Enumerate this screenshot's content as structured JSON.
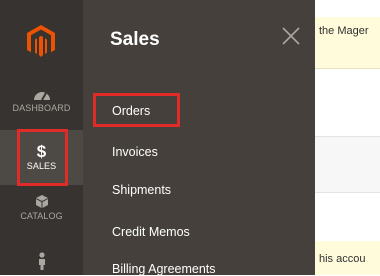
{
  "sidebar": {
    "logo_icon": "magento-logo-icon",
    "items": [
      {
        "label": "DASHBOARD",
        "icon": "speedometer-icon"
      },
      {
        "label": "SALES",
        "icon": "dollar-icon"
      },
      {
        "label": "CATALOG",
        "icon": "cube-icon"
      },
      {
        "label": "",
        "icon": "person-icon"
      }
    ]
  },
  "sales_menu": {
    "title": "Sales",
    "close_icon": "close-icon",
    "items": [
      {
        "label": "Orders"
      },
      {
        "label": "Invoices"
      },
      {
        "label": "Shipments"
      },
      {
        "label": "Credit Memos"
      },
      {
        "label": "Billing Agreements"
      }
    ]
  },
  "content": {
    "top_notice_text": "the Mager",
    "bottom_notice_text": "his accou"
  },
  "colors": {
    "sidebar_bg": "#373330",
    "panel_bg": "#45403b",
    "logo_orange": "#eb5202",
    "highlight_red": "#e02b27",
    "notice_bg": "#fffbdb"
  }
}
